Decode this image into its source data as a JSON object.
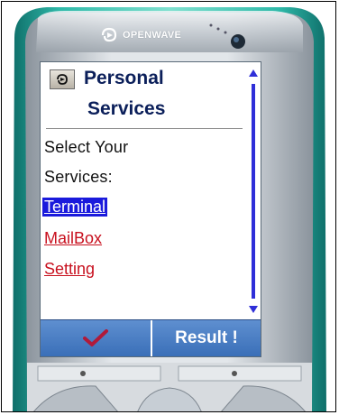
{
  "brand": {
    "name": "OPENWAVE"
  },
  "screen": {
    "title_line1": "Personal",
    "title_line2": "Services",
    "prompt_line1": "Select Your",
    "prompt_line2": "Services:",
    "links": [
      {
        "label": "Terminal",
        "selected": true
      },
      {
        "label": "MailBox",
        "selected": false
      },
      {
        "label": "Setting",
        "selected": false
      }
    ]
  },
  "softkeys": {
    "left_icon": "checkmark-icon",
    "right_label": "Result !"
  },
  "colors": {
    "phone_body": "#1fa79a",
    "faceplate": "#c9ced3",
    "title_text": "#0b1f5a",
    "link_color": "#c8111f",
    "selected_bg": "#1a1adc",
    "softkey_bar": "#4a7fc4",
    "check_color": "#b01a3a"
  }
}
